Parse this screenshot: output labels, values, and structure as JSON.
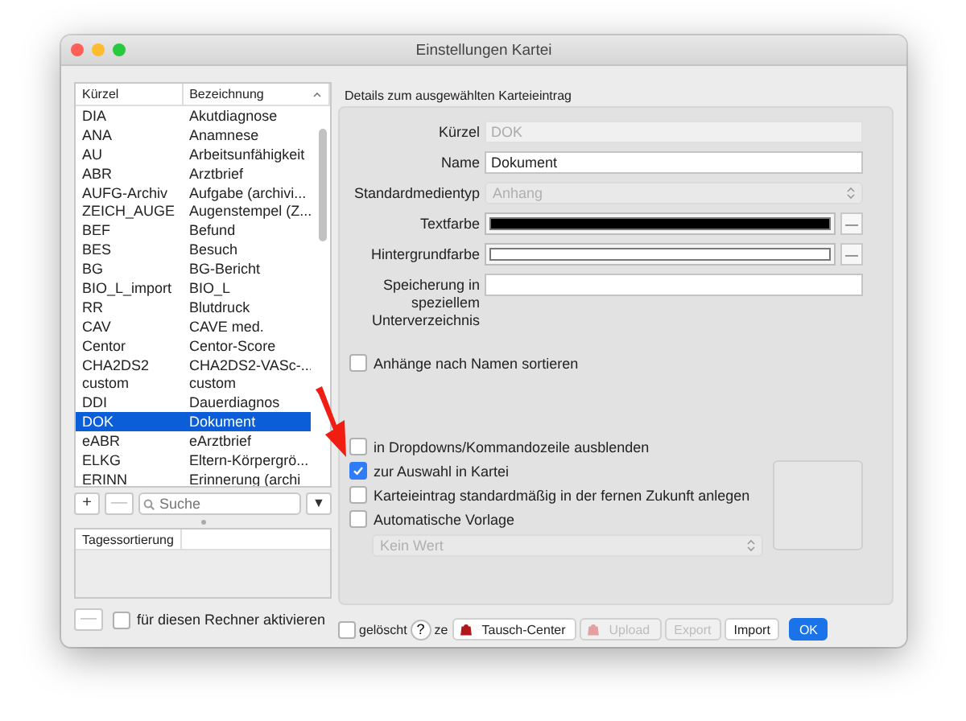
{
  "window": {
    "title": "Einstellungen Kartei"
  },
  "list": {
    "columns": [
      "Kürzel",
      "Bezeichnung"
    ],
    "rows": [
      {
        "code": "DIA",
        "name": "Akutdiagnose",
        "selected": false
      },
      {
        "code": "ANA",
        "name": "Anamnese",
        "selected": false
      },
      {
        "code": "AU",
        "name": "Arbeitsunfähigkeit",
        "selected": false
      },
      {
        "code": "ABR",
        "name": "Arztbrief",
        "selected": false
      },
      {
        "code": "AUFG-Archiv",
        "name": "Aufgabe (archivi...",
        "selected": false
      },
      {
        "code": "ZEICH_AUGE",
        "name": "Augenstempel (Z...",
        "selected": false
      },
      {
        "code": "BEF",
        "name": "Befund",
        "selected": false
      },
      {
        "code": "BES",
        "name": "Besuch",
        "selected": false
      },
      {
        "code": "BG",
        "name": "BG-Bericht",
        "selected": false
      },
      {
        "code": "BIO_L_import",
        "name": "BIO_L",
        "selected": false
      },
      {
        "code": "RR",
        "name": "Blutdruck",
        "selected": false
      },
      {
        "code": "CAV",
        "name": "CAVE med.",
        "selected": false
      },
      {
        "code": "Centor",
        "name": "Centor-Score",
        "selected": false
      },
      {
        "code": "CHA2DS2",
        "name": "CHA2DS2-VASc-...",
        "selected": false
      },
      {
        "code": "custom",
        "name": "custom",
        "selected": false
      },
      {
        "code": "DDI",
        "name": "Dauerdiagnos",
        "selected": false
      },
      {
        "code": "DOK",
        "name": "Dokument",
        "selected": true
      },
      {
        "code": "eABR",
        "name": "eArztbrief",
        "selected": false
      },
      {
        "code": "ELKG",
        "name": "Eltern-Körpergrö...",
        "selected": false
      },
      {
        "code": "ERINN",
        "name": "Erinnerung (archi",
        "selected": false
      }
    ],
    "add": "+",
    "remove": "—",
    "search": {
      "placeholder": "Suche"
    },
    "menu": "▼"
  },
  "day_sort": {
    "columns": [
      "Tagessortierung"
    ],
    "remove": "—",
    "activate": {
      "label": "für diesen Rechner aktivieren",
      "checked": false
    }
  },
  "details": {
    "title": "Details zum ausgewählten Karteieintrag",
    "fields": [
      {
        "kind": "text",
        "label": "Kürzel",
        "value": "DOK",
        "disabled": true
      },
      {
        "kind": "text",
        "label": "Name",
        "value": "Dokument",
        "disabled": false
      },
      {
        "kind": "select",
        "label": "Standardmedientyp",
        "value": "Anhang",
        "disabled": true
      },
      {
        "kind": "color",
        "label": "Textfarbe",
        "color": "#000000",
        "clear": "—"
      },
      {
        "kind": "color",
        "label": "Hintergrundfarbe",
        "color": "#ffffff",
        "clear": "—"
      },
      {
        "kind": "text",
        "label": "Speicherung in speziellem Unterverzeichnis",
        "disabled": false
      }
    ],
    "sort_attachments": {
      "label": "Anhänge nach Namen sortieren",
      "checked": false
    },
    "options": [
      {
        "label": "in Dropdowns/Kommandozeile ausblenden",
        "checked": false
      },
      {
        "label": "zur Auswahl in Kartei",
        "checked": true
      },
      {
        "label": "Karteieintrag standardmäßig in der fernen Zukunft anlegen",
        "checked": false
      },
      {
        "label": "Automatische Vorlage",
        "checked": false
      }
    ],
    "template": {
      "value": "Kein Wert",
      "disabled": true
    }
  },
  "footer": {
    "deleted": {
      "label": "gelöscht",
      "checked": false
    },
    "help": "?",
    "hidden_rest": "ze",
    "buttons": [
      {
        "label": "Tausch-Center",
        "icon": true,
        "disabled": false,
        "default": false
      },
      {
        "label": "Upload",
        "icon": true,
        "disabled": true,
        "default": false
      },
      {
        "label": "Export",
        "icon": false,
        "disabled": true,
        "default": false
      },
      {
        "label": "Import",
        "icon": false,
        "disabled": false,
        "default": false
      },
      {
        "label": "OK",
        "icon": false,
        "disabled": false,
        "default": true
      }
    ]
  }
}
